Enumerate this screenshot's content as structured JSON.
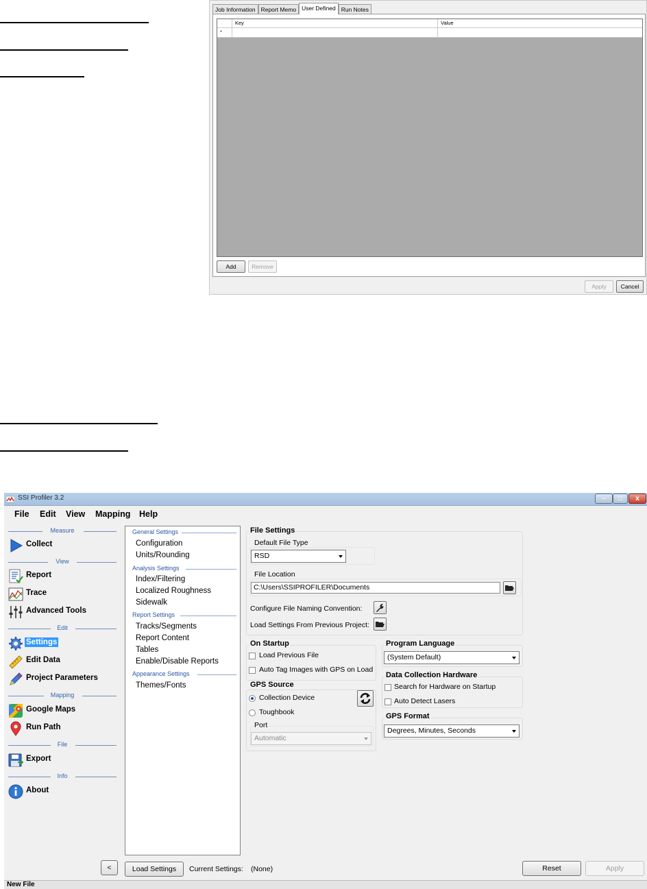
{
  "dialog": {
    "tabs": [
      "Job Information",
      "Report Memo",
      "User Defined",
      "Run Notes"
    ],
    "active_tab": "User Defined",
    "grid": {
      "columns": [
        "Key",
        "Value"
      ],
      "new_row_marker": "*"
    },
    "add_label": "Add",
    "remove_label": "Remove",
    "apply_label": "Apply",
    "cancel_label": "Cancel"
  },
  "window": {
    "title": "SSI Profiler 3.2",
    "min_glyph": "–",
    "max_glyph": "□",
    "close_glyph": "x"
  },
  "menu": {
    "items": [
      "File",
      "Edit",
      "View",
      "Mapping",
      "Help"
    ]
  },
  "nav": {
    "sections": {
      "measure": "Measure",
      "view": "View",
      "edit": "Edit",
      "mapping": "Mapping",
      "file": "File",
      "info": "Info"
    },
    "items": {
      "collect": "Collect",
      "report": "Report",
      "trace": "Trace",
      "advanced_tools": "Advanced Tools",
      "settings": "Settings",
      "edit_data": "Edit Data",
      "project_parameters": "Project Parameters",
      "google_maps": "Google Maps",
      "run_path": "Run Path",
      "export": "Export",
      "about": "About"
    },
    "selected": "Settings",
    "collapse_label": "<"
  },
  "tree": {
    "general": {
      "title": "General Settings",
      "items": [
        "Configuration",
        "Units/Rounding"
      ]
    },
    "analysis": {
      "title": "Analysis Settings",
      "items": [
        "Index/Filtering",
        "Localized Roughness",
        "Sidewalk"
      ]
    },
    "report": {
      "title": "Report Settings",
      "items": [
        "Tracks/Segments",
        "Report Content",
        "Tables",
        "Enable/Disable Reports"
      ]
    },
    "appearance": {
      "title": "Appearance Settings",
      "items": [
        "Themes/Fonts"
      ]
    }
  },
  "settings": {
    "file_settings": {
      "title": "File Settings",
      "default_file_type_label": "Default File Type",
      "default_file_type_value": "RSD",
      "file_location_label": "File Location",
      "file_location_value": "C:\\Users\\SSIPROFILER\\Documents",
      "naming_convention_label": "Configure File Naming Convention:",
      "load_previous_label": "Load Settings From Previous Project:"
    },
    "on_startup": {
      "title": "On Startup",
      "load_previous_file": "Load Previous File",
      "load_previous_file_checked": false,
      "auto_tag": "Auto Tag Images with GPS on Load",
      "auto_tag_checked": false
    },
    "gps_source": {
      "title": "GPS Source",
      "options": [
        "Collection Device",
        "Toughbook"
      ],
      "selected": "Collection Device",
      "port_label": "Port",
      "port_value": "Automatic"
    },
    "program_language": {
      "title": "Program Language",
      "value": "(System Default)"
    },
    "data_collection_hardware": {
      "title": "Data Collection Hardware",
      "search_on_startup": "Search for Hardware on Startup",
      "search_on_startup_checked": false,
      "auto_detect_lasers": "Auto Detect Lasers",
      "auto_detect_lasers_checked": false
    },
    "gps_format": {
      "title": "GPS Format",
      "value": "Degrees, Minutes, Seconds"
    }
  },
  "bottom": {
    "load_settings": "Load Settings",
    "current_settings_label": "Current Settings:",
    "current_settings_value": "(None)",
    "reset": "Reset",
    "apply": "Apply"
  },
  "status": {
    "text": "New File"
  },
  "colors": {
    "nav_selected": "#3399ff",
    "section_blue": "#3366aa",
    "grid_gray": "#ababab"
  }
}
